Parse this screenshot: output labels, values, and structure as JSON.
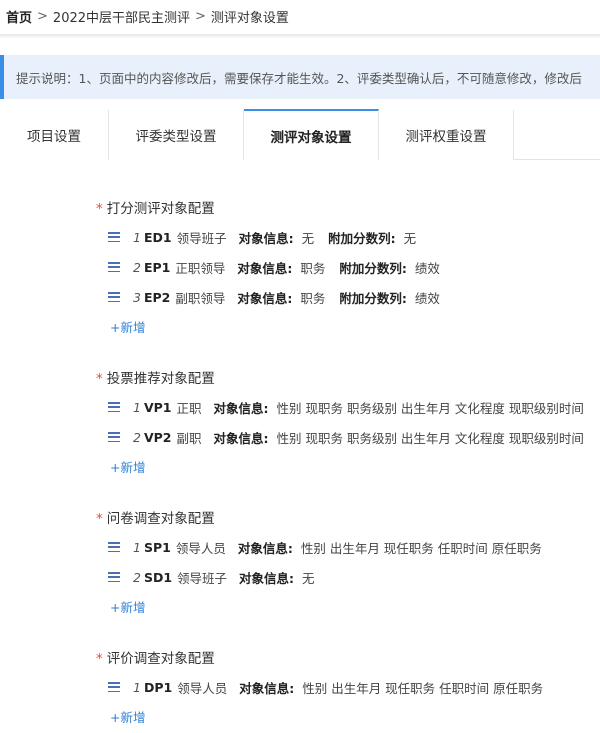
{
  "breadcrumb": {
    "home": "首页",
    "sep1": ">",
    "item1": "2022中层干部民主测评",
    "sep2": ">",
    "item2": "测评对象设置"
  },
  "notice": {
    "text": "提示说明：1、页面中的内容修改后，需要保存才能生效。2、评委类型确认后，不可随意修改，修改后"
  },
  "tabs": [
    {
      "label": "项目设置"
    },
    {
      "label": "评委类型设置"
    },
    {
      "label": "测评对象设置",
      "active": true
    },
    {
      "label": "测评权重设置"
    }
  ],
  "sections": [
    {
      "title": "打分测评对象配置",
      "rows": [
        {
          "num": "1",
          "code": "ED1",
          "name": "领导班子",
          "info_label": "对象信息:",
          "info": "无",
          "extra_label": "附加分数列:",
          "extra": "无"
        },
        {
          "num": "2",
          "code": "EP1",
          "name": "正职领导",
          "info_label": "对象信息:",
          "info": "职务",
          "extra_label": "附加分数列:",
          "extra": "绩效"
        },
        {
          "num": "3",
          "code": "EP2",
          "name": "副职领导",
          "info_label": "对象信息:",
          "info": "职务",
          "extra_label": "附加分数列:",
          "extra": "绩效"
        }
      ],
      "add": "+新增"
    },
    {
      "title": "投票推荐对象配置",
      "rows": [
        {
          "num": "1",
          "code": "VP1",
          "name": "正职",
          "info_label": "对象信息:",
          "info": "性别 现职务 职务级别 出生年月 文化程度 现职级别时间"
        },
        {
          "num": "2",
          "code": "VP2",
          "name": "副职",
          "info_label": "对象信息:",
          "info": "性别 现职务 职务级别 出生年月 文化程度 现职级别时间"
        }
      ],
      "add": "+新增"
    },
    {
      "title": "问卷调查对象配置",
      "rows": [
        {
          "num": "1",
          "code": "SP1",
          "name": "领导人员",
          "info_label": "对象信息:",
          "info": "性别 出生年月 现任职务 任职时间 原任职务"
        },
        {
          "num": "2",
          "code": "SD1",
          "name": "领导班子",
          "info_label": "对象信息:",
          "info": "无"
        }
      ],
      "add": "+新增"
    },
    {
      "title": "评价调查对象配置",
      "rows": [
        {
          "num": "1",
          "code": "DP1",
          "name": "领导人员",
          "info_label": "对象信息:",
          "info": "性别 出生年月 现任职务 任职时间 原任职务"
        }
      ],
      "add": "+新增"
    }
  ],
  "colors": {
    "accent": "#3a8ee6",
    "link": "#2d7fd6",
    "required": "#e74c3c",
    "notice_bg": "#e8f1fb"
  },
  "icons": {
    "drag": "drag-handle-icon"
  }
}
